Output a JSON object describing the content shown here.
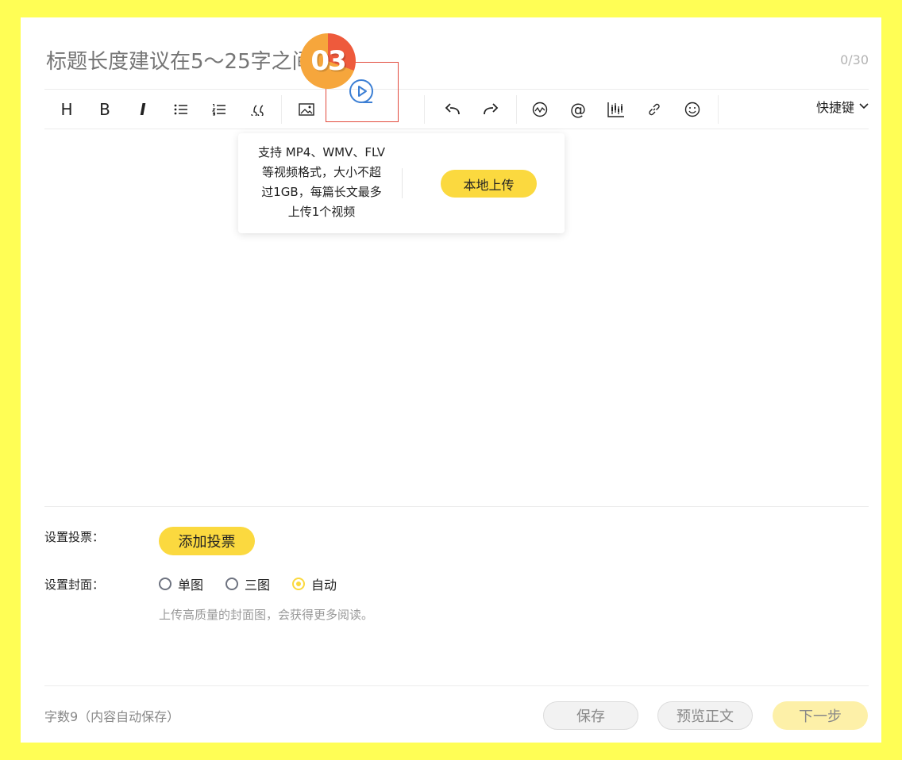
{
  "editor": {
    "title_placeholder": "标题长度建议在5～25字之间",
    "title_count": "0/30"
  },
  "toolbar": {
    "heading_label": "H",
    "bold_label": "B",
    "italic_label": "I",
    "shortcut_label": "快捷键"
  },
  "badge": {
    "text": "03"
  },
  "video_popup": {
    "line1": "支持 MP4、WMV、FLV",
    "line2": "等视频格式，大小不超",
    "line3": "过1GB，每篇长文最多",
    "line4": "上传1个视频",
    "upload_label": "本地上传"
  },
  "vote": {
    "label": "设置投票：",
    "button_label": "添加投票"
  },
  "cover": {
    "label": "设置封面：",
    "options": [
      {
        "label": "单图",
        "checked": false
      },
      {
        "label": "三图",
        "checked": false
      },
      {
        "label": "自动",
        "checked": true
      }
    ],
    "hint": "上传高质量的封面图，会获得更多阅读。"
  },
  "footer": {
    "word_count": "字数9（内容自动保存）",
    "save_label": "保存",
    "preview_label": "预览正文",
    "next_label": "下一步"
  },
  "colors": {
    "background": "#fffe55",
    "accent": "#fbd93f",
    "highlight_border": "#e24b3d",
    "video_icon": "#3c7fd4"
  }
}
